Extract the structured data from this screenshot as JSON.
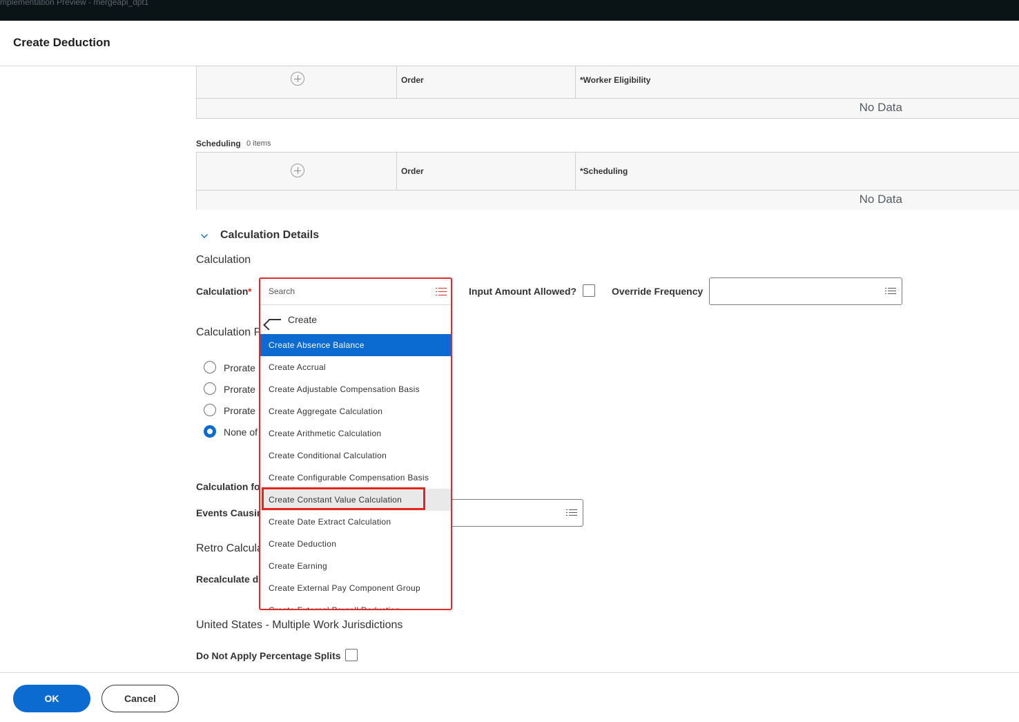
{
  "topbar": {
    "text": "mplementation Preview - mergeapi_dpt1"
  },
  "header": {
    "title": "Create Deduction"
  },
  "worker_eligibility_grid": {
    "columns": [
      "Order",
      "*Worker Eligibility"
    ],
    "empty_text": "No Data"
  },
  "scheduling": {
    "label": "Scheduling",
    "count": "0 items",
    "columns": [
      "Order",
      "*Scheduling"
    ],
    "empty_text": "No Data"
  },
  "calculation_details": {
    "title": "Calculation Details",
    "subsection": "Calculation",
    "calculation_label": "Calculation",
    "required_mark": "*",
    "input_amount_label": "Input Amount Allowed?",
    "override_frequency_label": "Override Frequency",
    "proration_label": "Calculation P",
    "radio_options": [
      "Prorate",
      "Prorate",
      "Prorate",
      "None of"
    ],
    "calc_for_label": "Calculation for",
    "events_label": "Events Causing",
    "retro_label": "Retro Calcula",
    "recalc_label": "Recalculate du",
    "jurisdictions_label": "United States - Multiple Work Jurisdictions",
    "percentage_splits_label": "Do Not Apply Percentage Splits"
  },
  "dropdown": {
    "search_placeholder": "Search",
    "back_label": "Create",
    "items": [
      "Create Absence Balance",
      "Create Accrual",
      "Create Adjustable Compensation Basis",
      "Create Aggregate Calculation",
      "Create Arithmetic Calculation",
      "Create Conditional Calculation",
      "Create Configurable Compensation Basis",
      "Create Constant Value Calculation",
      "Create Date Extract Calculation",
      "Create Deduction",
      "Create Earning",
      "Create External Pay Component Group",
      "Create External Payroll Deduction"
    ]
  },
  "footer": {
    "ok_label": "OK",
    "cancel_label": "Cancel"
  },
  "colors": {
    "accent": "#0b6bd1",
    "error": "#e12b2b"
  }
}
